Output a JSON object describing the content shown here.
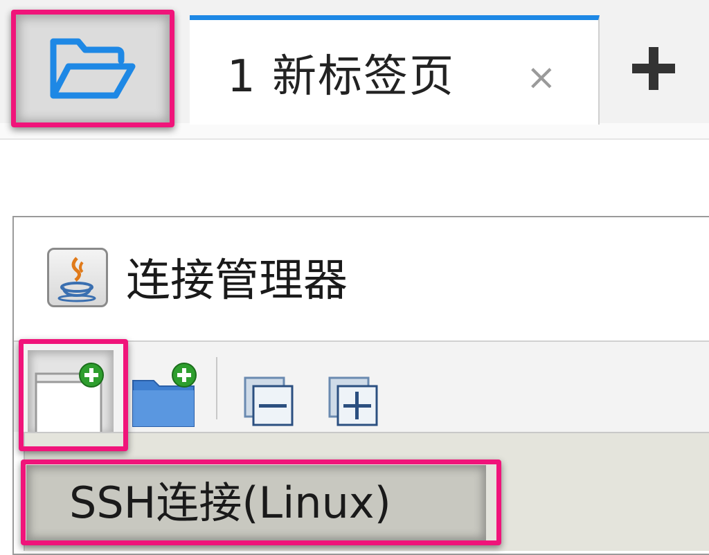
{
  "tab_bar": {
    "folder_icon": "folder-open-icon",
    "tab": {
      "title": "1 新标签页",
      "close_glyph": "×"
    },
    "add_tab_icon": "plus-icon",
    "accent": "#1e88e5"
  },
  "connection_manager": {
    "icon": "java-icon",
    "title": "连接管理器",
    "toolbar": {
      "new_connection_icon": "new-connection-icon",
      "new_folder_icon": "new-folder-icon",
      "collapse_icon": "collapse-all-icon",
      "expand_icon": "expand-all-icon"
    },
    "menu_item": {
      "label": "SSH连接(Linux)"
    }
  },
  "highlight_color": "#f0147a"
}
